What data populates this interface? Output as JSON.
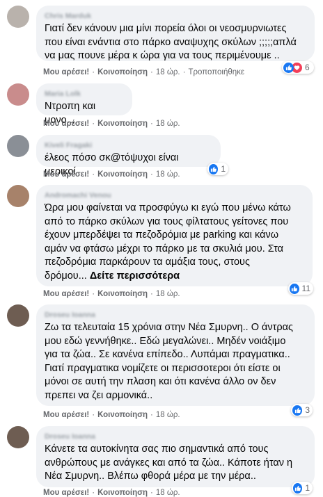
{
  "actions": {
    "like_label": "Μου αρέσει!",
    "share_label": "Κοινοποίηση",
    "separator": "·",
    "time": "18 ώρ.",
    "edited_label": "Τροποποιήθηκε"
  },
  "comments": [
    {
      "author": "Chris Marduk",
      "lines": [
        "Γιατί δεν κάνουν μια μίνι πορεία όλοι οι νεοσμυρνιωτες",
        "που είναι ενάντια στο πάρκο αναψυχης σκύλων ;;;;;απλά",
        "να μας πουνε μέρα κ ώρα για να τους περιμένουμε .."
      ],
      "reaction_count": "6",
      "reaction_types": [
        "like-icon",
        "love-icon"
      ]
    },
    {
      "author": "Maria Lolk",
      "lines": [
        "Ντροπη και μονο..."
      ]
    },
    {
      "author": "Kiveli Fragaki",
      "lines": [
        "έλεος πόσο σκ@τόψυχοι είναι μερικοί"
      ],
      "reaction_count": "1",
      "reaction_types": [
        "like-icon"
      ]
    },
    {
      "author": "Andromachi Venou",
      "lines": [
        "Ώρα μου φαίνεται να προσφύγω κι εγώ που μένω κάτω",
        "από το πάρκο σκύλων για τους φίλτατους γείτονες που",
        "έχουν μπερδέψει τα πεζοδρόμια με parking και κάνω",
        "αμάν να φτάσω μέχρι το πάρκο με τα σκυλιά μου. Στα",
        "πεζοδρόμια παρκάρουν τα αμάξια τους, στους",
        "δρόμου..."
      ],
      "see_more": "Δείτε περισσότερα",
      "reaction_count": "11",
      "reaction_types": [
        "like-icon"
      ]
    },
    {
      "author": "Droseu Ioanna",
      "lines": [
        "Ζω τα τελευταία 15 χρόνια στην Νέα Σμυρνη.. Ο άντρας",
        "μου εδώ γεννήθηκε.. Εδώ μεγαλώνει.. Μηδέν νοιάξιμο",
        "για τα ζώα.. Σε κανένα επίπεδο.. Λυπάμαι πραγματικα..",
        "Γιατί πραγματικα νομίζετε οι περισσοτεροι ότι είστε οι",
        "μόνοι σε αυτή την πλαση και ότι κανένα άλλο ον δεν",
        "πρεπει να ζει αρμονικά.."
      ],
      "reaction_count": "3",
      "reaction_types": [
        "like-icon"
      ]
    },
    {
      "author": "Droseu Ioanna",
      "lines": [
        "Κάνετε τα αυτοκίνητα σας πιο σημαντικά από τους",
        "ανθρώπους με ανάγκες και από τα ζώα.. Κάποτε ήταν η",
        "Νέα Σμυρνη.. Βλέπω φθορά μέρα με την μέρα.."
      ],
      "reaction_count": "1",
      "reaction_types": [
        "like-icon"
      ]
    }
  ],
  "colors": {
    "like": "#1877f2",
    "love": "#f33e58",
    "bubble": "#f0f2f5",
    "meta": "#65676b"
  }
}
